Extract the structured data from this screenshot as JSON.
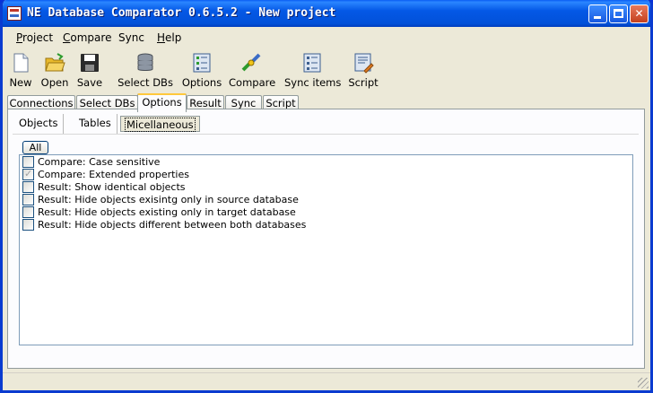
{
  "window": {
    "title": "NE Database Comparator 0.6.5.2 - New project"
  },
  "menu": [
    {
      "label": "Project",
      "accel": "P"
    },
    {
      "label": "Compare",
      "accel": "C"
    },
    {
      "label": "Sync",
      "accel": ""
    },
    {
      "label": "Help",
      "accel": "H"
    }
  ],
  "toolbar": [
    {
      "label": "New",
      "icon": "new-document-icon"
    },
    {
      "label": "Open",
      "icon": "open-folder-icon"
    },
    {
      "label": "Save",
      "icon": "floppy-disk-icon"
    },
    {
      "label": "Select DBs",
      "icon": "database-stack-icon"
    },
    {
      "label": "Options",
      "icon": "options-list-icon"
    },
    {
      "label": "Compare",
      "icon": "compare-icon"
    },
    {
      "label": "Sync items",
      "icon": "sync-list-icon"
    },
    {
      "label": "Script",
      "icon": "script-icon"
    }
  ],
  "tabs": [
    "Connections",
    "Select DBs",
    "Options",
    "Result",
    "Sync",
    "Script"
  ],
  "active_tab": "Options",
  "subtabs": [
    "Objects",
    "Tables",
    "Micellaneous"
  ],
  "active_subtab": "Micellaneous",
  "all_button": "All",
  "options": [
    {
      "label": "Compare: Case sensitive",
      "checked": false
    },
    {
      "label": "Compare: Extended properties",
      "checked": true
    },
    {
      "label": "Result: Show identical objects",
      "checked": false
    },
    {
      "label": "Result: Hide objects exisintg only in source database",
      "checked": false
    },
    {
      "label": "Result: Hide objects existing only in target database",
      "checked": false
    },
    {
      "label": "Result: Hide objects different between both databases",
      "checked": false
    }
  ]
}
